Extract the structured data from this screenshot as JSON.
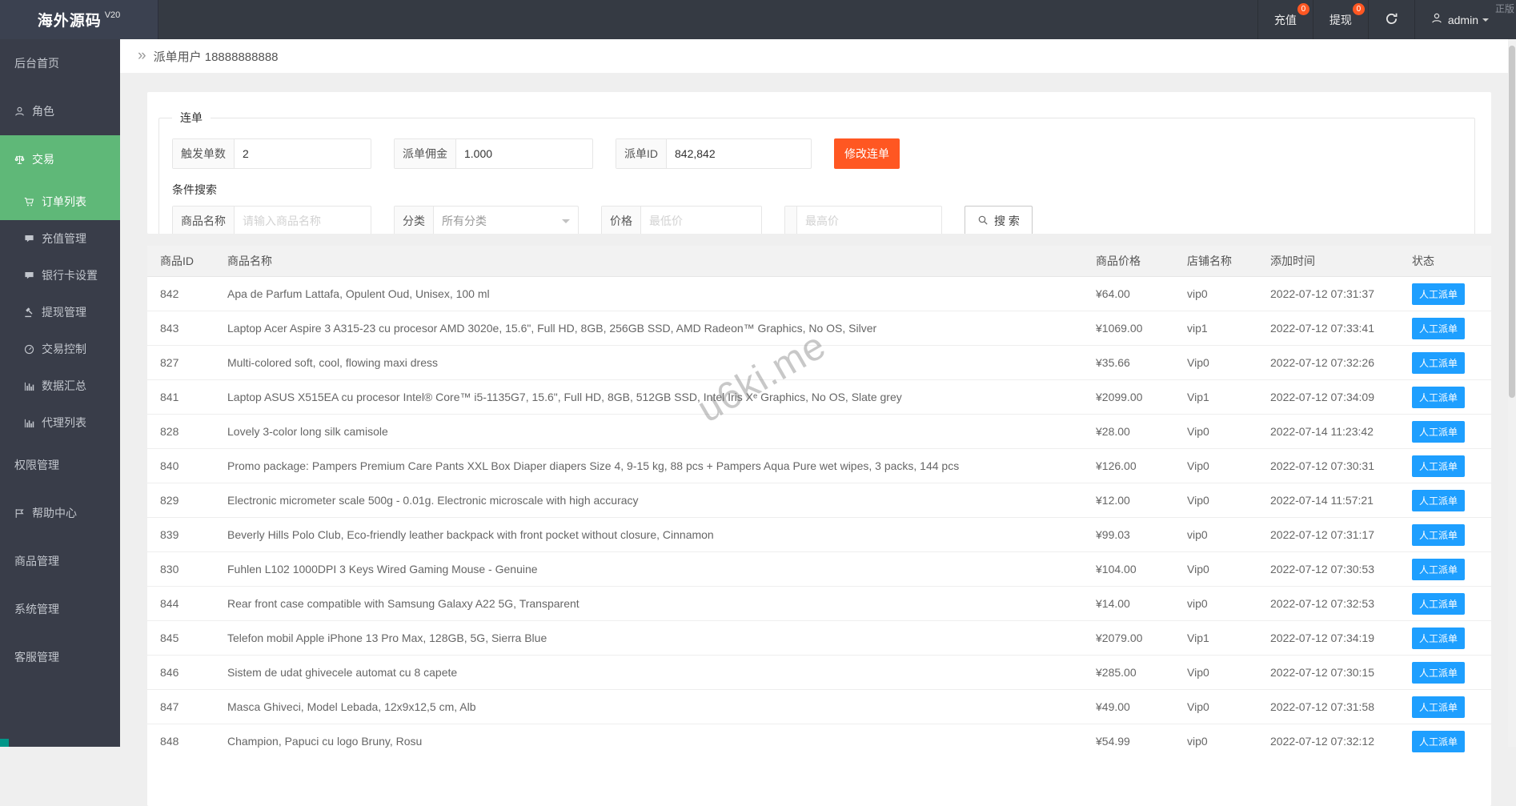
{
  "header": {
    "brand": "海外源码",
    "brand_version": "V20",
    "corner_text": "正版",
    "nav": [
      {
        "label": "充值",
        "badge": "0"
      },
      {
        "label": "提现",
        "badge": "0"
      }
    ],
    "user": "admin"
  },
  "sidebar": {
    "items": [
      {
        "key": "dashboard",
        "label": "后台首页",
        "icon": null,
        "level": 1,
        "selected": false
      },
      {
        "key": "roles",
        "label": "角色",
        "icon": "person-icon",
        "level": 1,
        "selected": false
      },
      {
        "key": "trade",
        "label": "交易",
        "icon": "scales-icon",
        "level": 1,
        "selected": true
      },
      {
        "key": "order-list",
        "label": "订单列表",
        "icon": "cart-icon",
        "level": 2,
        "selected": true
      },
      {
        "key": "recharge-manage",
        "label": "充值管理",
        "icon": "comment-icon",
        "level": 2,
        "selected": false
      },
      {
        "key": "bank-card-settings",
        "label": "银行卡设置",
        "icon": "comment-icon",
        "level": 2,
        "selected": false
      },
      {
        "key": "withdraw-manage",
        "label": "提现管理",
        "icon": "gavel-icon",
        "level": 2,
        "selected": false
      },
      {
        "key": "trade-control",
        "label": "交易控制",
        "icon": "gauge-icon",
        "level": 2,
        "selected": false
      },
      {
        "key": "data-summary",
        "label": "数据汇总",
        "icon": "chart-icon",
        "level": 2,
        "selected": false
      },
      {
        "key": "agent-list",
        "label": "代理列表",
        "icon": "chart-icon",
        "level": 2,
        "selected": false
      },
      {
        "key": "permission-manage",
        "label": "权限管理",
        "icon": null,
        "level": 1,
        "selected": false
      },
      {
        "key": "help-center",
        "label": "帮助中心",
        "icon": "flag-icon",
        "level": 1,
        "selected": false
      },
      {
        "key": "product-manage",
        "label": "商品管理",
        "icon": null,
        "level": 1,
        "selected": false
      },
      {
        "key": "system-manage",
        "label": "系统管理",
        "icon": null,
        "level": 1,
        "selected": false
      },
      {
        "key": "service-manage",
        "label": "客服管理",
        "icon": null,
        "level": 1,
        "selected": false
      }
    ]
  },
  "breadcrumb": {
    "title": "派单用户 18888888888"
  },
  "panel": {
    "legend": "连单",
    "fields": [
      {
        "label": "触发单数",
        "value": "2"
      },
      {
        "label": "派单佣金",
        "value": "1.000"
      },
      {
        "label": "派单ID",
        "value": "842,842"
      }
    ],
    "submit_label": "修改连单",
    "search_title": "条件搜索",
    "search": {
      "name_label": "商品名称",
      "name_placeholder": "请输入商品名称",
      "category_label": "分类",
      "category_value": "所有分类",
      "price_label": "价格",
      "min_placeholder": "最低价",
      "max_placeholder": "最高价",
      "search_label": "搜 索"
    }
  },
  "table": {
    "columns": [
      "商品ID",
      "商品名称",
      "商品价格",
      "店铺名称",
      "添加时间",
      "状态"
    ],
    "action_label": "人工派单",
    "rows": [
      {
        "id": "842",
        "name": "Apa de Parfum Lattafa, Opulent Oud, Unisex, 100 ml",
        "price": "¥64.00",
        "shop": "vip0",
        "time": "2022-07-12 07:31:37"
      },
      {
        "id": "843",
        "name": "Laptop Acer Aspire 3 A315-23 cu procesor AMD 3020e, 15.6\", Full HD, 8GB, 256GB SSD, AMD Radeon™ Graphics, No OS, Silver",
        "price": "¥1069.00",
        "shop": "vip1",
        "time": "2022-07-12 07:33:41"
      },
      {
        "id": "827",
        "name": "Multi-colored soft, cool, flowing maxi dress",
        "price": "¥35.66",
        "shop": "Vip0",
        "time": "2022-07-12 07:32:26"
      },
      {
        "id": "841",
        "name": "Laptop ASUS X515EA cu procesor Intel® Core™ i5-1135G7, 15.6\", Full HD, 8GB, 512GB SSD, Intel Iris Xᵉ Graphics, No OS, Slate grey",
        "price": "¥2099.00",
        "shop": "Vip1",
        "time": "2022-07-12 07:34:09"
      },
      {
        "id": "828",
        "name": "Lovely 3-color long silk camisole",
        "price": "¥28.00",
        "shop": "Vip0",
        "time": "2022-07-14 11:23:42"
      },
      {
        "id": "840",
        "name": "Promo package: Pampers Premium Care Pants XXL Box Diaper diapers Size 4, 9-15 kg, 88 pcs + Pampers Aqua Pure wet wipes, 3 packs, 144 pcs",
        "price": "¥126.00",
        "shop": "Vip0",
        "time": "2022-07-12 07:30:31"
      },
      {
        "id": "829",
        "name": "Electronic micrometer scale 500g - 0.01g. Electronic microscale with high accuracy",
        "price": "¥12.00",
        "shop": "Vip0",
        "time": "2022-07-14 11:57:21"
      },
      {
        "id": "839",
        "name": "Beverly Hills Polo Club, Eco-friendly leather backpack with front pocket without closure, Cinnamon",
        "price": "¥99.03",
        "shop": "vip0",
        "time": "2022-07-12 07:31:17"
      },
      {
        "id": "830",
        "name": "Fuhlen L102 1000DPI 3 Keys Wired Gaming Mouse - Genuine",
        "price": "¥104.00",
        "shop": "Vip0",
        "time": "2022-07-12 07:30:53"
      },
      {
        "id": "844",
        "name": "Rear front case compatible with Samsung Galaxy A22 5G, Transparent",
        "price": "¥14.00",
        "shop": "vip0",
        "time": "2022-07-12 07:32:53"
      },
      {
        "id": "845",
        "name": "Telefon mobil Apple iPhone 13 Pro Max, 128GB, 5G, Sierra Blue",
        "price": "¥2079.00",
        "shop": "Vip1",
        "time": "2022-07-12 07:34:19"
      },
      {
        "id": "846",
        "name": "Sistem de udat ghivecele automat cu 8 capete",
        "price": "¥285.00",
        "shop": "Vip0",
        "time": "2022-07-12 07:30:15"
      },
      {
        "id": "847",
        "name": "Masca Ghiveci, Model Lebada, 12x9x12,5 cm, Alb",
        "price": "¥49.00",
        "shop": "Vip0",
        "time": "2022-07-12 07:31:58"
      },
      {
        "id": "848",
        "name": "Champion, Papuci cu logo Bruny, Rosu",
        "price": "¥54.99",
        "shop": "vip0",
        "time": "2022-07-12 07:32:12"
      }
    ]
  },
  "watermark": "u6ki.me",
  "colors": {
    "primary_green": "#5FB878",
    "accent_orange": "#FF5722",
    "action_blue": "#1E9FFF",
    "header_dark": "#393D49"
  }
}
